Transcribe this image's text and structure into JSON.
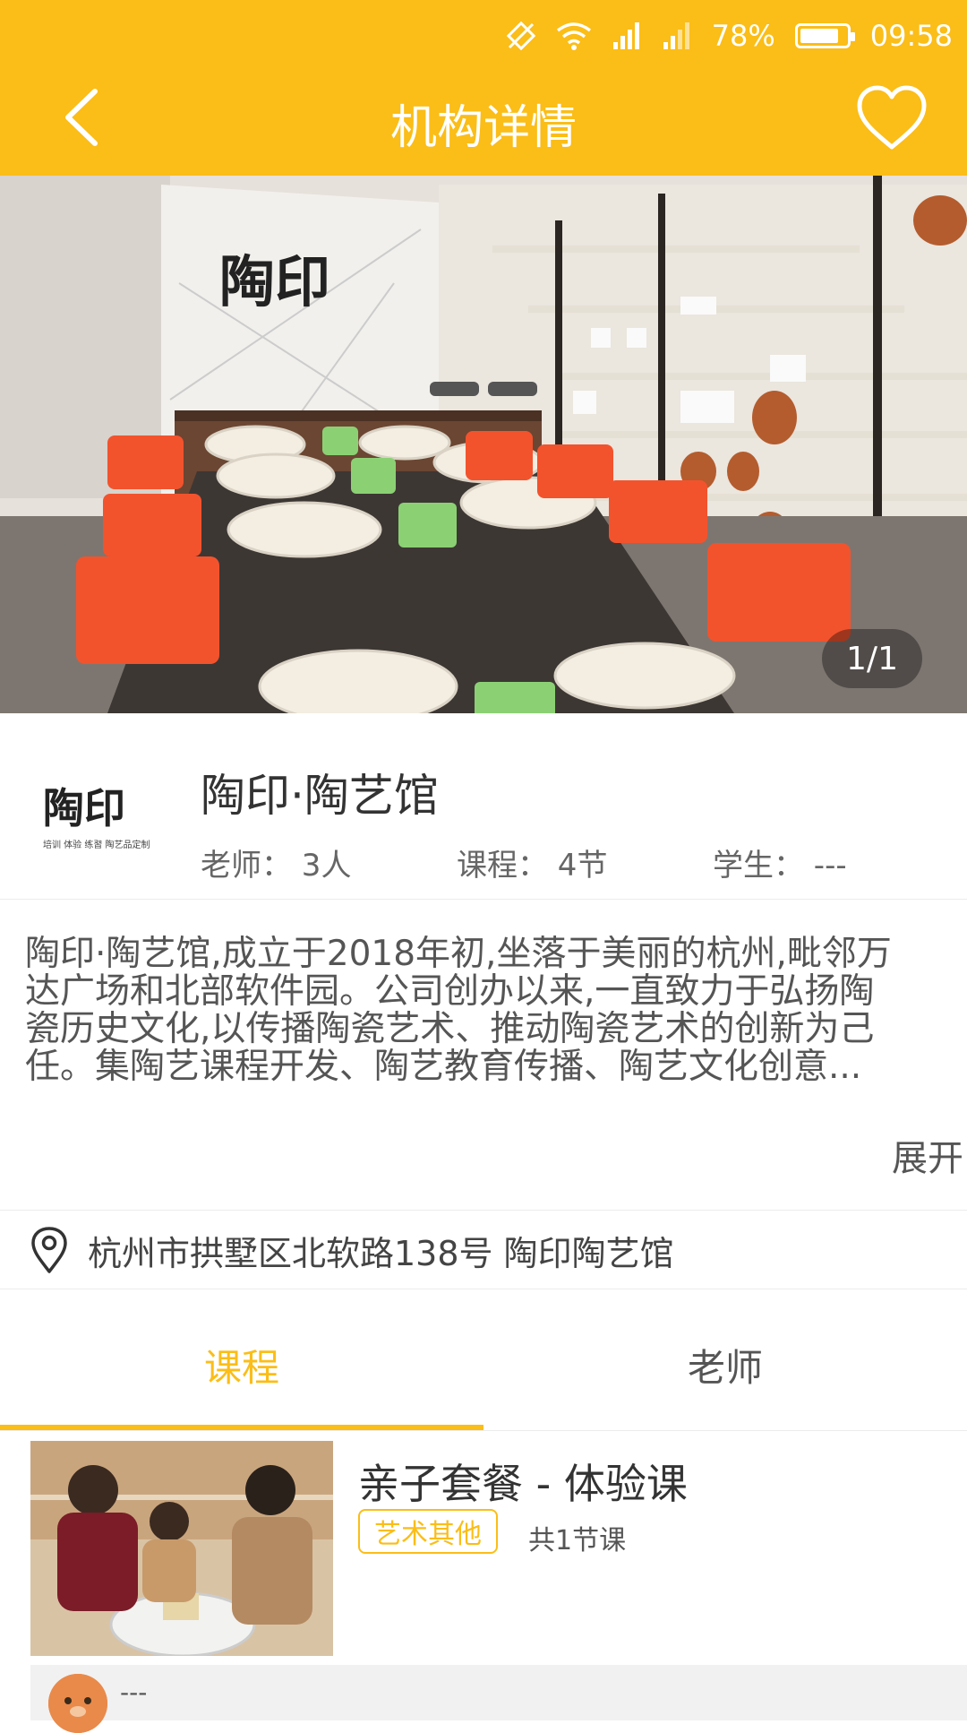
{
  "status_bar": {
    "battery": "78%",
    "time": "09:58"
  },
  "header": {
    "title": "机构详情"
  },
  "hero": {
    "counter": "1/1",
    "sign_text": "陶印"
  },
  "org": {
    "name": "陶印·陶艺馆",
    "logo_text": "陶印",
    "logo_caption": "培训 体验 练習 陶艺品定制",
    "teachers": "老师：  3人",
    "courses": "课程：  4节",
    "students": "学生：  ---"
  },
  "description": {
    "lines": [
      "陶印·陶艺馆,成立于2018年初,坐落于美丽的杭州,毗邻万",
      "达广场和北部软件园。公司创办以来,一直致力于弘扬陶",
      "瓷历史文化,以传播陶瓷艺术、推动陶瓷艺术的创新为己",
      "任。集陶艺课程开发、陶艺教育传播、陶艺文化创意..."
    ],
    "expand_label": "展开"
  },
  "address": {
    "text": "杭州市拱墅区北软路138号 陶印陶艺馆"
  },
  "tabs": [
    {
      "label": "课程"
    },
    {
      "label": "老师"
    }
  ],
  "course": {
    "name": "亲子套餐 - 体验课",
    "tag": "艺术其他",
    "lessons": "共1节课"
  },
  "teacher_row": {
    "name": "---"
  },
  "colors": {
    "accent": "#fbbd17"
  }
}
